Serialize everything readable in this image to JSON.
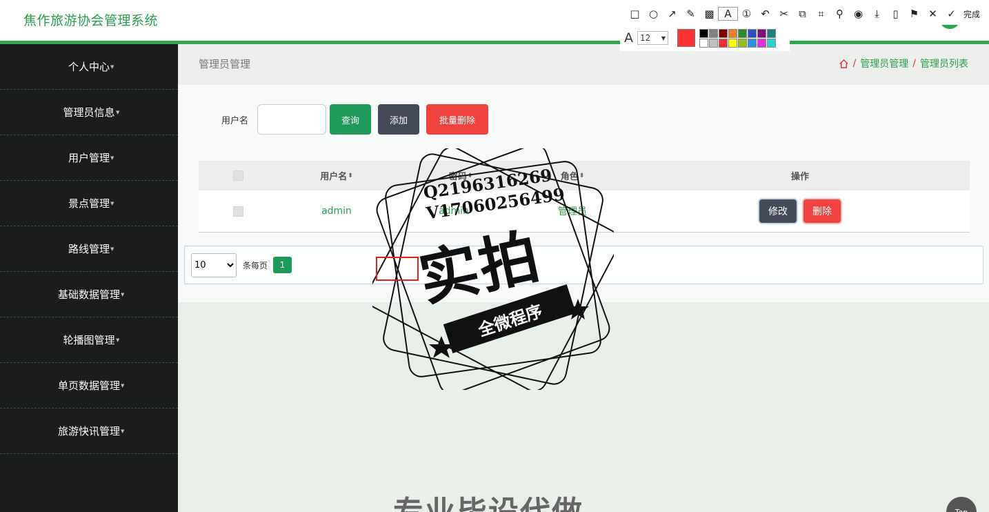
{
  "app": {
    "title": "焦作旅游协会管理系统"
  },
  "sidebar": {
    "items": [
      {
        "label": "个人中心"
      },
      {
        "label": "管理员信息"
      },
      {
        "label": "用户管理"
      },
      {
        "label": "景点管理"
      },
      {
        "label": "路线管理"
      },
      {
        "label": "基础数据管理"
      },
      {
        "label": "轮播图管理"
      },
      {
        "label": "单页数据管理"
      },
      {
        "label": "旅游快讯管理"
      }
    ]
  },
  "breadcrumb": {
    "page_title": "管理员管理",
    "path": [
      "管理员管理",
      "管理员列表"
    ],
    "separator": "/"
  },
  "search": {
    "label": "用户名",
    "value": "",
    "query_label": "查询",
    "add_label": "添加",
    "batch_delete_label": "批量删除"
  },
  "table": {
    "headers": {
      "username": "用户名",
      "password": "密码",
      "role": "角色",
      "actions": "操作"
    },
    "rows": [
      {
        "username": "admin",
        "password": "admin",
        "role": "管理员",
        "edit_label": "修改",
        "delete_label": "删除"
      }
    ]
  },
  "pagination": {
    "page_size": "10",
    "per_page_label": "条每页",
    "current_page": "1"
  },
  "back_to_top": "Top",
  "toolbar": {
    "font_size": "12",
    "done_label": "完成",
    "current_color": "#f33333"
  },
  "watermark": {
    "line1": "Q2196316269",
    "line2": "V17060256499",
    "big": "实拍",
    "band": "全微程序",
    "bottom": "专业毕设代做"
  },
  "colors": {
    "accent": "#2aa84d",
    "sidebar_bg": "#1b1c1c",
    "danger": "#f0433f",
    "dark": "#444a57"
  }
}
